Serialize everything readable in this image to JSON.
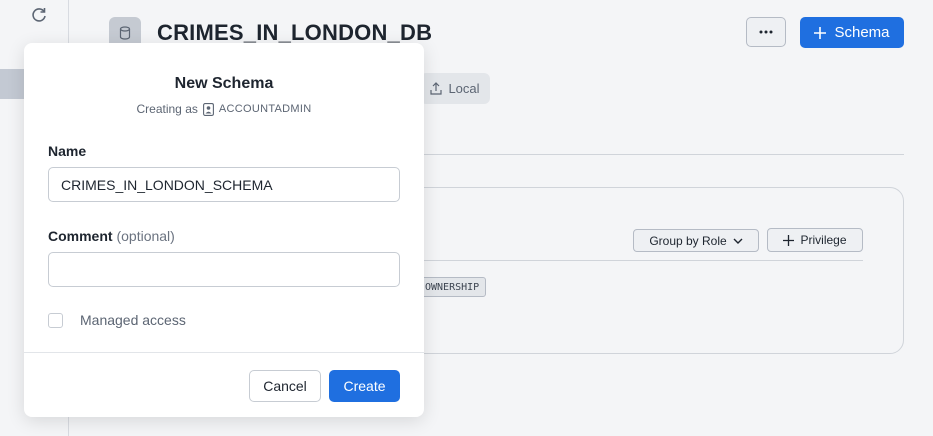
{
  "header": {
    "database_title": "CRIMES_IN_LONDON_DB",
    "more_label": "···",
    "schema_button_label": "Schema"
  },
  "tabs": {
    "local_label": "Local"
  },
  "privileges": {
    "group_by_label": "Group by Role",
    "add_privilege_label": "Privilege",
    "ownership_badge": "OWNERSHIP"
  },
  "modal": {
    "title": "New Schema",
    "creating_as_prefix": "Creating as",
    "role": "ACCOUNTADMIN",
    "name_label": "Name",
    "name_value": "CRIMES_IN_LONDON_SCHEMA",
    "comment_label": "Comment",
    "comment_optional": "(optional)",
    "comment_value": "",
    "managed_access_label": "Managed access",
    "managed_access_checked": false,
    "cancel_label": "Cancel",
    "create_label": "Create"
  },
  "colors": {
    "accent": "#1f6fe0",
    "background": "#f4f5f7"
  },
  "icons": [
    "refresh-icon",
    "database-icon",
    "plus-icon",
    "upload-icon",
    "chevron-down-icon",
    "user-badge-icon"
  ]
}
